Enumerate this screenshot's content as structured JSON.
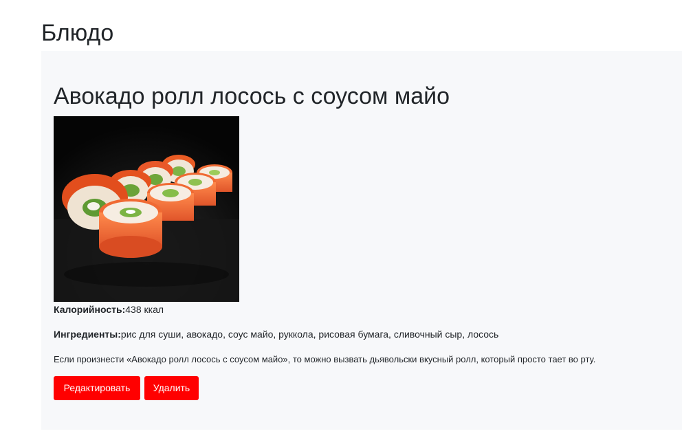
{
  "page": {
    "heading": "Блюдо"
  },
  "dish": {
    "title": "Авокадо ролл лосось с соусом майо",
    "image_alt": "Авокадо ролл лосось с соусом майо",
    "calories_label": "Калорийность:",
    "calories_value": "438 ккал",
    "ingredients_label": "Ингредиенты:",
    "ingredients_value": "рис для суши, авокадо, соус майо, руккола, рисовая бумага, сливочный сыр, лосось",
    "description": "Если произнести «Авокадо ролл лосось с соусом майо», то можно вызвать дьявольски вкусный ролл, который просто тает во рту."
  },
  "actions": {
    "edit_label": "Редактировать",
    "delete_label": "Удалить"
  },
  "colors": {
    "button_bg": "#ff0000",
    "card_bg": "#f7f8fa",
    "text": "#212529"
  }
}
